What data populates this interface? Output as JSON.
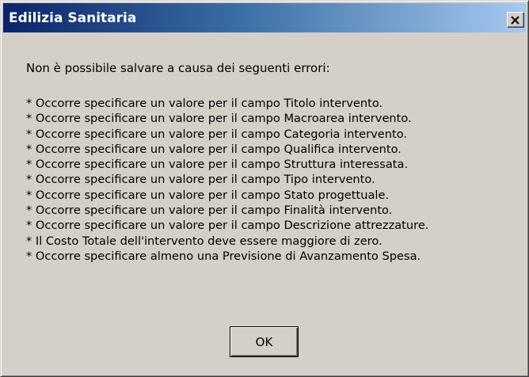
{
  "window": {
    "title": "Edilizia Sanitaria",
    "close_icon": "close-x-icon"
  },
  "message": {
    "intro": "Non è possibile salvare a causa dei seguenti errori:",
    "errors": [
      "* Occorre specificare un valore per il campo Titolo intervento.",
      "* Occorre specificare un valore per il campo Macroarea intervento.",
      "* Occorre specificare un valore per il campo Categoria intervento.",
      "* Occorre specificare un valore per il campo Qualifica intervento.",
      "* Occorre specificare un valore per il campo Struttura interessata.",
      "* Occorre specificare un valore per il campo Tipo intervento.",
      "* Occorre specificare un valore per il campo Stato progettuale.",
      "* Occorre specificare un valore per il campo Finalità intervento.",
      "* Occorre specificare un valore per il campo Descrizione attrezzature.",
      "* Il Costo Totale dell'intervento deve essere maggiore di zero.",
      "* Occorre specificare almeno una Previsione di Avanzamento Spesa."
    ]
  },
  "buttons": {
    "ok_label": "OK"
  },
  "colors": {
    "titlebar_start": "#0a246a",
    "titlebar_end": "#a6caf0",
    "face": "#d4d0c8"
  }
}
